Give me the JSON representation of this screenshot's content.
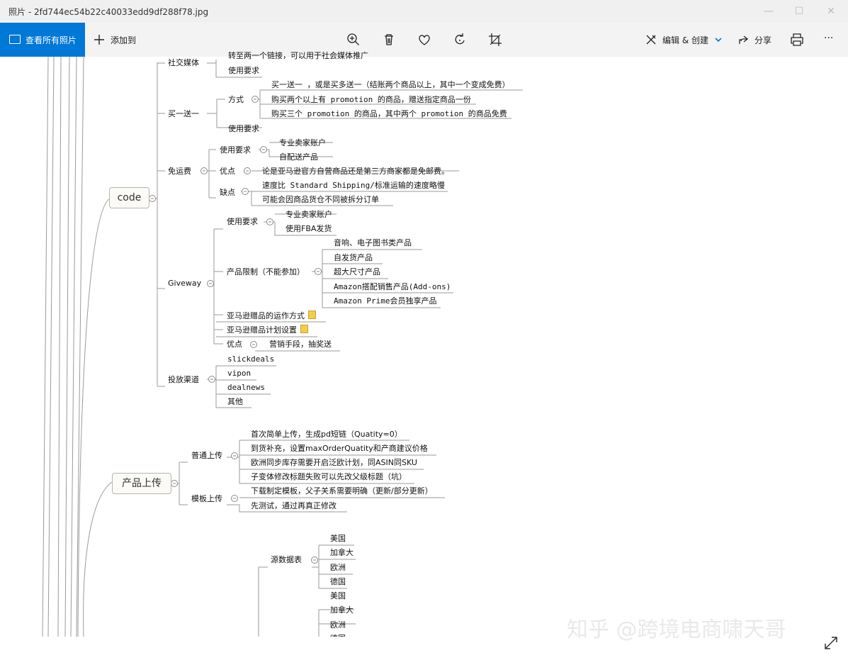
{
  "window": {
    "title": "照片 - 2fd744ec54b22c40033edd9df288f78.jpg",
    "minimize": "—",
    "maximize": "☐",
    "close": "✕"
  },
  "toolbar": {
    "view_all": "查看所有照片",
    "add_to": "添加到",
    "edit_create": "编辑 & 创建",
    "share": "分享",
    "more": "···"
  },
  "mindmap": {
    "social": {
      "label": "社交媒体",
      "truncated": "转至两一个链接，可以用于社会媒体推广",
      "req": "使用要求"
    },
    "bogo": {
      "label": "买一送一",
      "method": "方式",
      "items": [
        "买一送一 ，或是买多送一（结账两个商品以上，其中一个变成免费）",
        "购买两个以上有 promotion 的商品，赠送指定商品一份",
        "购买三个 promotion 的商品，其中两个 promotion 的商品免费"
      ],
      "req": "使用要求"
    },
    "free_ship": {
      "label": "免运费",
      "req": "使用要求",
      "req_items": [
        "专业卖家账户",
        "自配送产品"
      ],
      "pro": "优点",
      "pro_text": "论是亚马逊官方自营商品还是第三方商家都是免邮费。",
      "con": "缺点",
      "con_items": [
        "速度比 Standard Shipping/标准运输的速度略慢",
        "可能会因商品货仓不同被拆分订单"
      ]
    },
    "code": "code",
    "giveway": {
      "label": "Giveway",
      "req": "使用要求",
      "req_items": [
        "专业卖家账户",
        "使用FBA发货"
      ],
      "limit": "产品限制（不能参加）",
      "limit_items": [
        "音响、电子图书类产品",
        "自发货产品",
        "超大尺寸产品",
        "Amazon搭配销售产品(Add-ons)",
        "Amazon Prime会员独享产品"
      ],
      "how": "亚马逊赠品的运作方式",
      "setup": "亚马逊赠品计划设置",
      "pro": "优点",
      "pro_text": "营销手段，抽奖送"
    },
    "channels": {
      "label": "投放渠道",
      "items": [
        "slickdeals",
        "vipon",
        "dealnews",
        "其他"
      ]
    },
    "upload": {
      "label": "产品上传",
      "normal": "普通上传",
      "normal_items": [
        "首次简单上传，生成pd短链（Quatity=0）",
        "到货补充，设置maxOrderQuatity和产商建议价格",
        "欧洲同步库存需要开启泛欧计划，同ASIN同SKU",
        "子变体修改标题失败可以先改父级标题（坑）"
      ],
      "template": "模板上传",
      "template_items": [
        "下载制定模板，父子关系需要明确（更新/部分更新）",
        "先测试，通过再真正修改"
      ]
    },
    "source": {
      "label": "源数据表",
      "items": [
        "美国",
        "加拿大",
        "欧洲",
        "德国"
      ],
      "items2": [
        "美国",
        "加拿大",
        "欧洲",
        "德国"
      ]
    }
  },
  "watermark": "知乎 @跨境电商啸天哥",
  "colors": {
    "accent": "#0078d7",
    "titlebar": "#f0f0f0",
    "toolbar": "#f3f3f3",
    "line": "#9a9a9a"
  }
}
